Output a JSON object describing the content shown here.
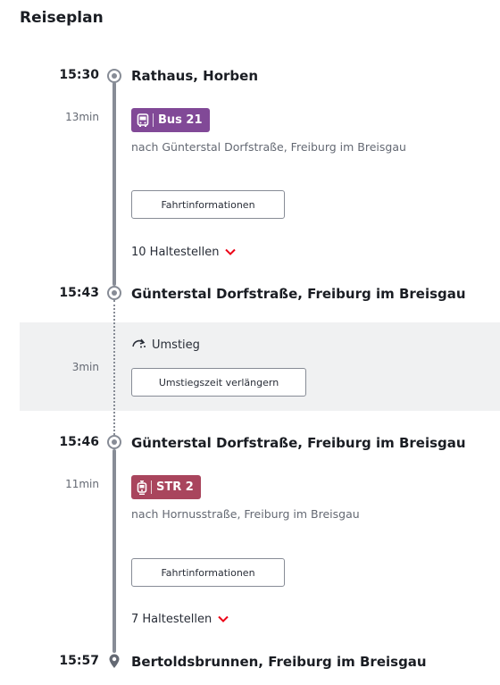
{
  "page": {
    "title": "Reiseplan"
  },
  "journey": {
    "stops": {
      "start": {
        "time": "15:30",
        "station": "Rathaus, Horben"
      },
      "transfer_arrive": {
        "time": "15:43",
        "station": "Günterstal Dorfstraße, Freiburg im Breisgau"
      },
      "transfer_depart": {
        "time": "15:46",
        "station": "Günterstal Dorfstraße, Freiburg im Breisgau"
      },
      "end": {
        "time": "15:57",
        "station": "Bertoldsbrunnen, Freiburg im Breisgau"
      }
    },
    "legs": [
      {
        "duration": "13min",
        "line": "Bus 21",
        "mode_icon": "bus-icon",
        "color": "#814997",
        "direction": "nach Günterstal Dorfstraße, Freiburg im Breisgau",
        "info_button": "Fahrtinformationen",
        "stops_toggle": "10 Haltestellen"
      },
      {
        "duration": "11min",
        "line": "STR 2",
        "mode_icon": "tram-icon",
        "color": "#a9455d",
        "direction": "nach Hornusstraße, Freiburg im Breisgau",
        "info_button": "Fahrtinformationen",
        "stops_toggle": "7 Haltestellen"
      }
    ],
    "transfer": {
      "duration": "3min",
      "label": "Umstieg",
      "icon": "transfer-icon",
      "extend_button": "Umstiegszeit verlängern"
    }
  },
  "colors": {
    "accent_red": "#ec0016",
    "timeline": "#878c96",
    "transfer_band": "#f0f1f2"
  }
}
